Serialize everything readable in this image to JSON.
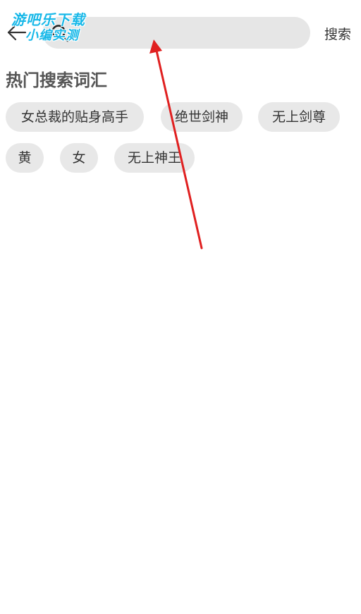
{
  "header": {
    "back_icon": "back-arrow-icon",
    "search_icon": "search-icon",
    "search_value": "",
    "search_placeholder": "",
    "search_action_label": "搜索"
  },
  "hot_search": {
    "title": "热门搜索词汇",
    "tags": [
      {
        "label": "女总裁的贴身高手"
      },
      {
        "label": "绝世剑神"
      },
      {
        "label": "无上剑尊"
      },
      {
        "label": "黄"
      },
      {
        "label": "女"
      },
      {
        "label": "无上神王"
      }
    ]
  },
  "watermark": {
    "line1": "游吧乐下载",
    "line2": "小编实测"
  },
  "colors": {
    "search_bg": "#e6e6e6",
    "tag_bg": "#e8e8e8",
    "text": "#333333",
    "section_title": "#555555",
    "watermark": "#18b8e8",
    "annotation_arrow": "#e02020"
  }
}
